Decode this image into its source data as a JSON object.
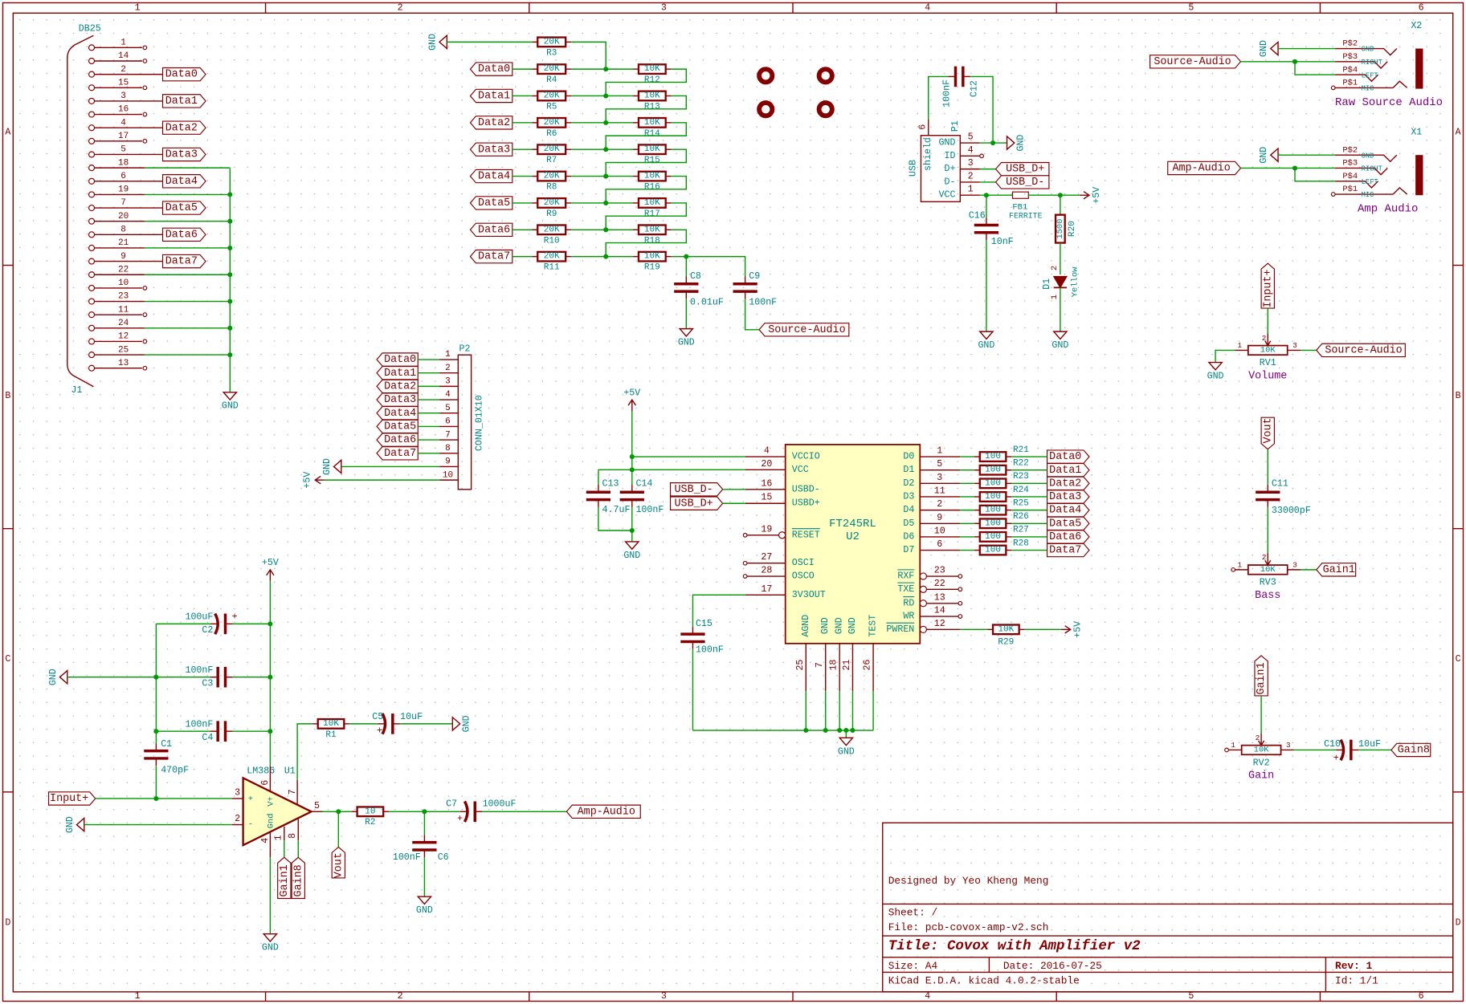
{
  "colors": {
    "line": "#840000",
    "text": "#008484",
    "wire": "#009900",
    "body_fill": "#ffffc2",
    "field": "#840084"
  },
  "net": {
    "gnd": "GND",
    "vcc": "+5V",
    "plus": "+",
    "minus": "-"
  },
  "frame": {
    "columns": [
      "1",
      "2",
      "3",
      "4",
      "5",
      "6"
    ],
    "rows": [
      "A",
      "B",
      "C",
      "D"
    ]
  },
  "title_block": {
    "designer": "Designed by Yeo Kheng Meng",
    "sheet": "Sheet: /",
    "file": "File: pcb-covox-amp-v2.sch",
    "title": "Title: Covox with Amplifier v2",
    "size": "Size: A4",
    "date": "Date: 2016-07-25",
    "rev": "Rev: 1",
    "tool": "KiCad E.D.A.  kicad 4.0.2-stable",
    "id": "Id: 1/1"
  },
  "j1": {
    "ref": "J1",
    "value": "DB25",
    "pins": [
      "1",
      "14",
      "2",
      "15",
      "3",
      "16",
      "4",
      "17",
      "5",
      "18",
      "6",
      "19",
      "7",
      "20",
      "8",
      "21",
      "9",
      "22",
      "10",
      "23",
      "11",
      "24",
      "12",
      "25",
      "13"
    ],
    "data_labels": [
      "Data0",
      "Data1",
      "Data2",
      "Data3",
      "Data4",
      "Data5",
      "Data6",
      "Data7"
    ]
  },
  "dac": {
    "inputs": [
      "Data0",
      "Data1",
      "Data2",
      "Data3",
      "Data4",
      "Data5",
      "Data6",
      "Data7"
    ],
    "r_series_value": "20K",
    "r_ladder_value": "10K",
    "top_ref": "R3",
    "series_refs": [
      "R4",
      "R5",
      "R6",
      "R7",
      "R8",
      "R9",
      "R10",
      "R11"
    ],
    "ladder_refs": [
      "R12",
      "R13",
      "R14",
      "R15",
      "R16",
      "R17",
      "R18",
      "R19"
    ],
    "c8": {
      "ref": "C8",
      "value": "0.01uF"
    },
    "c9": {
      "ref": "C9",
      "value": "100nF"
    },
    "output_label": "Source-Audio"
  },
  "p2": {
    "ref": "P2",
    "value": "CONN_01X10",
    "pins": [
      "1",
      "2",
      "3",
      "4",
      "5",
      "6",
      "7",
      "8",
      "9",
      "10"
    ],
    "labels": [
      "Data0",
      "Data1",
      "Data2",
      "Data3",
      "Data4",
      "Data5",
      "Data6",
      "Data7"
    ]
  },
  "usb": {
    "ref": "P1",
    "value": "USB",
    "shield": "shield",
    "shield_pin": "6",
    "pins": [
      {
        "name": "GND",
        "num": "5"
      },
      {
        "name": "ID",
        "num": "4"
      },
      {
        "name": "D+",
        "num": "3"
      },
      {
        "name": "D-",
        "num": "2"
      },
      {
        "name": "VCC",
        "num": "1"
      }
    ],
    "d_plus": "USB_D+",
    "d_minus": "USB_D-",
    "c12": {
      "ref": "C12",
      "value": "100nF"
    },
    "c16": {
      "ref": "C16",
      "value": "10nF"
    },
    "fb1": {
      "ref": "FB1",
      "value": "FERRITE"
    },
    "r20": {
      "ref": "R20",
      "value": "1500"
    },
    "d1": {
      "ref": "D1",
      "value": "Yellow",
      "pin_a": "2",
      "pin_k": "1"
    }
  },
  "jacks": [
    {
      "ref": "X2",
      "name": "Raw Source Audio",
      "net": "Source-Audio",
      "pins": [
        {
          "pad": "P$2",
          "fn": "GND"
        },
        {
          "pad": "P$3",
          "fn": "RIGHT"
        },
        {
          "pad": "P$4",
          "fn": "LEFT"
        },
        {
          "pad": "P$1",
          "fn": "MIC"
        }
      ]
    },
    {
      "ref": "X1",
      "name": "Amp Audio",
      "net": "Amp-Audio",
      "pins": [
        {
          "pad": "P$2",
          "fn": "GND"
        },
        {
          "pad": "P$3",
          "fn": "RIGHT"
        },
        {
          "pad": "P$4",
          "fn": "LEFT"
        },
        {
          "pad": "P$1",
          "fn": "MIC"
        }
      ]
    }
  ],
  "pots": {
    "pin1": "1",
    "pin2": "2",
    "pin3": "3",
    "rv1": {
      "ref": "RV1",
      "value": "10K",
      "name": "Volume",
      "top_label": "Input+",
      "right_label": "Source-Audio"
    },
    "rv3": {
      "ref": "RV3",
      "value": "10K",
      "name": "Bass",
      "top_label": "Vout",
      "right_label": "Gain1",
      "c11": {
        "ref": "C11",
        "value": "33000pF"
      }
    },
    "rv2": {
      "ref": "RV2",
      "value": "10K",
      "name": "Gain",
      "top_label": "Gain1",
      "right_label": "Gain8",
      "c10": {
        "ref": "C10",
        "value": "10uF"
      }
    }
  },
  "ft245": {
    "ref": "U2",
    "value": "FT245RL",
    "left_pins": [
      {
        "name": "VCCIO",
        "num": "4"
      },
      {
        "name": "VCC",
        "num": "20"
      },
      {
        "name": "USBD-",
        "num": "16"
      },
      {
        "name": "USBD+",
        "num": "15"
      },
      {
        "name": "RESET",
        "num": "19"
      },
      {
        "name": "OSCI",
        "num": "27"
      },
      {
        "name": "OSCO",
        "num": "28"
      },
      {
        "name": "3V3OUT",
        "num": "17"
      }
    ],
    "data_pins": [
      {
        "name": "D0",
        "num": "1"
      },
      {
        "name": "D1",
        "num": "5"
      },
      {
        "name": "D2",
        "num": "3"
      },
      {
        "name": "D3",
        "num": "11"
      },
      {
        "name": "D4",
        "num": "2"
      },
      {
        "name": "D5",
        "num": "9"
      },
      {
        "name": "D6",
        "num": "10"
      },
      {
        "name": "D7",
        "num": "6"
      }
    ],
    "ctrl_pins": [
      {
        "name": "RXF",
        "num": "23"
      },
      {
        "name": "TXE",
        "num": "22"
      },
      {
        "name": "RD",
        "num": "13"
      },
      {
        "name": "WR",
        "num": "14"
      },
      {
        "name": "PWREN",
        "num": "12"
      }
    ],
    "bottom_pins": [
      {
        "name": "AGND",
        "num": "25"
      },
      {
        "name": "GND",
        "num": "7"
      },
      {
        "name": "GND",
        "num": "18"
      },
      {
        "name": "GND",
        "num": "21"
      },
      {
        "name": "TEST",
        "num": "26"
      }
    ],
    "data_res_value": "100",
    "data_res_refs": [
      "R21",
      "R22",
      "R23",
      "R24",
      "R25",
      "R26",
      "R27",
      "R28"
    ],
    "outputs": [
      "Data0",
      "Data1",
      "Data2",
      "Data3",
      "Data4",
      "Data5",
      "Data6",
      "Data7"
    ],
    "r29": {
      "ref": "R29",
      "value": "10K"
    },
    "c13": {
      "ref": "C13",
      "value": "4.7uF"
    },
    "c14": {
      "ref": "C14",
      "value": "100nF"
    },
    "c15": {
      "ref": "C15",
      "value": "100nF"
    },
    "usb_dm": "USB_D-",
    "usb_dp": "USB_D+"
  },
  "amp": {
    "u1": {
      "ref": "U1",
      "value": "LM386",
      "gnd": "Gnd",
      "vplus": "V+",
      "pins": {
        "p1": "1",
        "p2": "2",
        "p3": "3",
        "p4": "4",
        "p5": "5",
        "p6": "6",
        "p7": "7",
        "p8": "8"
      }
    },
    "c1": {
      "ref": "C1",
      "value": "470pF"
    },
    "c2": {
      "ref": "C2",
      "value": "100uF"
    },
    "c3": {
      "ref": "C3",
      "value": "100nF"
    },
    "c4": {
      "ref": "C4",
      "value": "100nF"
    },
    "c5": {
      "ref": "C5",
      "value": "10uF"
    },
    "c6": {
      "ref": "C6",
      "value": "100nF"
    },
    "c7": {
      "ref": "C7",
      "value": "1000uF"
    },
    "r1": {
      "ref": "R1",
      "value": "10K"
    },
    "r2": {
      "ref": "R2",
      "value": "10"
    },
    "labels": {
      "input": "Input+",
      "gain1": "Gain1",
      "gain8": "Gain8",
      "vout": "Vout",
      "amp_audio": "Amp-Audio"
    }
  }
}
